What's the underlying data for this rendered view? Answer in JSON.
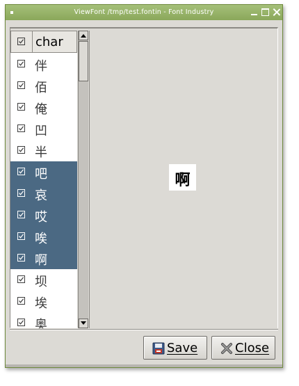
{
  "window": {
    "title": "ViewFont /tmp/test.fontin - Font Industry"
  },
  "char_list": {
    "header_label": "char",
    "header_checked": true,
    "rows": [
      {
        "char": "伴",
        "checked": true,
        "selected": false
      },
      {
        "char": "佰",
        "checked": true,
        "selected": false
      },
      {
        "char": "俺",
        "checked": true,
        "selected": false
      },
      {
        "char": "凹",
        "checked": true,
        "selected": false
      },
      {
        "char": "半",
        "checked": true,
        "selected": false
      },
      {
        "char": "吧",
        "checked": true,
        "selected": true
      },
      {
        "char": "哀",
        "checked": true,
        "selected": true
      },
      {
        "char": "哎",
        "checked": true,
        "selected": true
      },
      {
        "char": "唉",
        "checked": true,
        "selected": true
      },
      {
        "char": "啊",
        "checked": true,
        "selected": true
      },
      {
        "char": "坝",
        "checked": true,
        "selected": false
      },
      {
        "char": "埃",
        "checked": true,
        "selected": false
      },
      {
        "char": "奥",
        "checked": true,
        "selected": false
      }
    ]
  },
  "preview": {
    "glyph": "啊"
  },
  "buttons": {
    "save_label": "Save",
    "close_label": "Close"
  },
  "colors": {
    "titlebar": "#8aa75a",
    "selection": "#4b6983",
    "window_bg": "#dcdad5"
  },
  "icons": {
    "save": "floppy-disk-icon",
    "close": "x-close-icon"
  }
}
